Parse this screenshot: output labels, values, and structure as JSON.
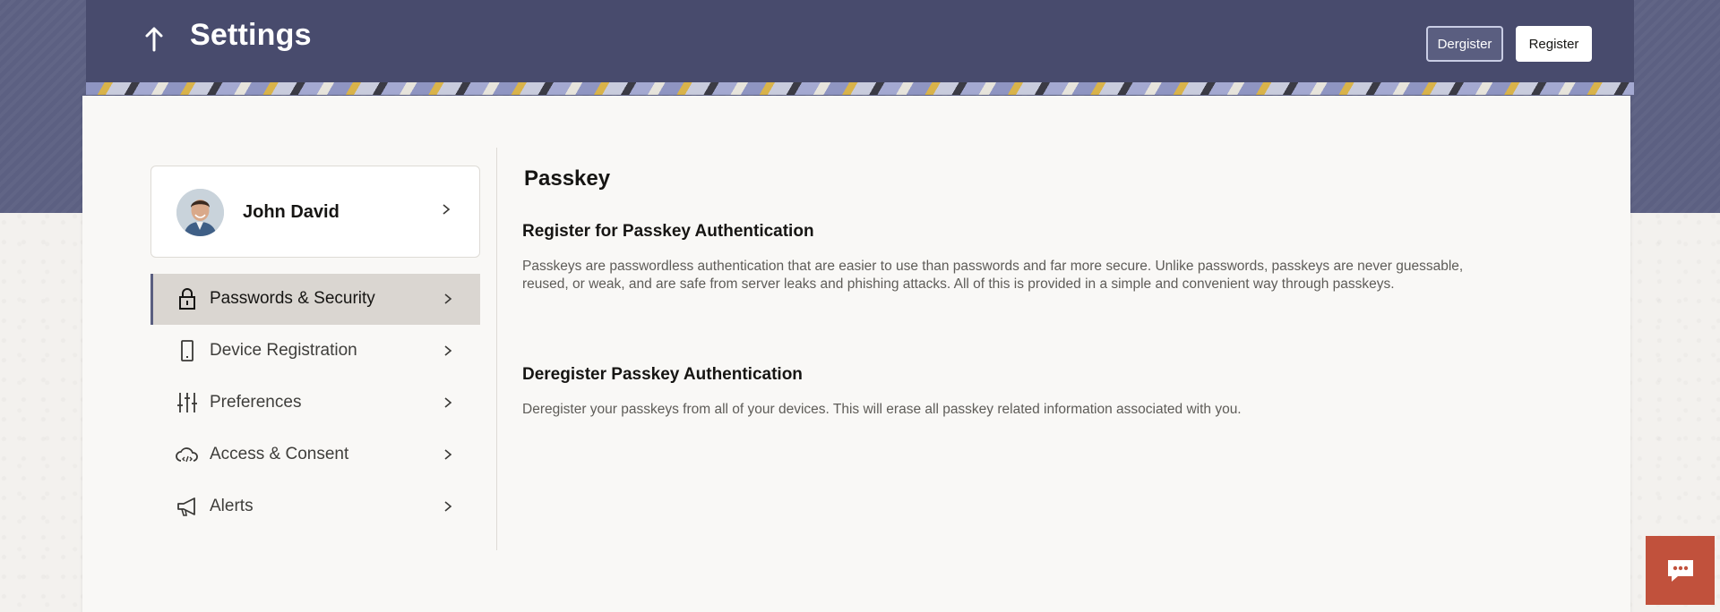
{
  "header": {
    "title": "Settings",
    "back_icon": "arrow-up-icon",
    "deregister_label": "Dergister",
    "register_label": "Register"
  },
  "profile": {
    "name": "John David"
  },
  "nav": {
    "items": [
      {
        "label": "Passwords & Security",
        "icon": "lock-icon",
        "active": true
      },
      {
        "label": "Device Registration",
        "icon": "device-icon",
        "active": false
      },
      {
        "label": "Preferences",
        "icon": "sliders-icon",
        "active": false
      },
      {
        "label": "Access & Consent",
        "icon": "cloud-code-icon",
        "active": false
      },
      {
        "label": "Alerts",
        "icon": "megaphone-icon",
        "active": false
      }
    ]
  },
  "content": {
    "title": "Passkey",
    "register_heading": "Register for Passkey Authentication",
    "register_text": "Passkeys are passwordless authentication that are easier to use than passwords and far more secure. Unlike passwords, passkeys are never guessable, reused, or weak, and are safe from server leaks and phishing attacks. All of this is provided in a simple and convenient way through passkeys.",
    "deregister_heading": "Deregister Passkey Authentication",
    "deregister_text": "Deregister your passkeys from all of your devices. This will erase all passkey related information associated with you."
  },
  "colors": {
    "header_bg": "#484b6d",
    "accent": "#5a5e80",
    "chat_button": "#c1513c"
  }
}
